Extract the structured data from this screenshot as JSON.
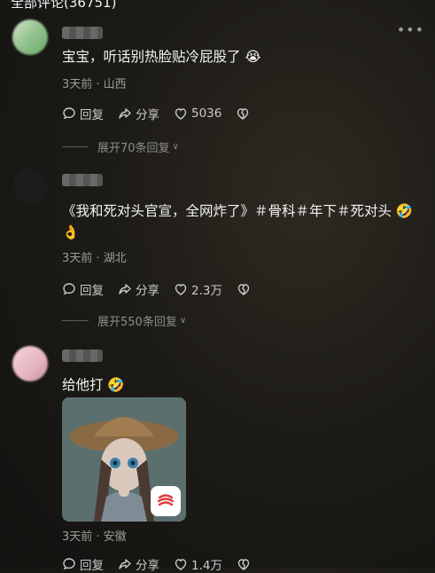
{
  "header": {
    "title": "全部评论(36751)"
  },
  "comments": [
    {
      "text": "宝宝，听话别热脸贴冷屁股了 😭",
      "meta": "3天前 · 山西",
      "reply": "回复",
      "share": "分享",
      "likes": "5036",
      "expand": "展开70条回复"
    },
    {
      "text": "《我和死对头官宣，全网炸了》＃骨科＃年下＃死对头 🤣 👌",
      "meta": "3天前 · 湖北",
      "reply": "回复",
      "share": "分享",
      "likes": "2.3万",
      "expand": "展开550条回复"
    },
    {
      "text": "给他打 🤣",
      "meta": "3天前 · 安徽",
      "reply": "回复",
      "share": "分享",
      "likes": "1.4万"
    }
  ],
  "colors": {
    "avatar1": "#8fbf8a",
    "avatar2": "#1e1e1e",
    "avatar3": "#e6b5c2",
    "accent": "#e8e8e8"
  }
}
